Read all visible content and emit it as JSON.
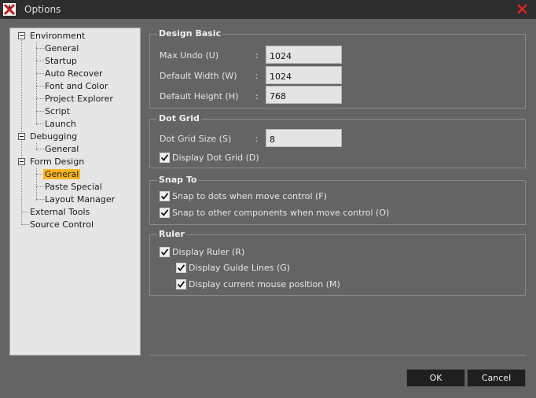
{
  "window": {
    "title": "Options"
  },
  "tree": {
    "items": [
      {
        "label": "Environment"
      },
      {
        "label": "General"
      },
      {
        "label": "Startup"
      },
      {
        "label": "Auto Recover"
      },
      {
        "label": "Font and Color"
      },
      {
        "label": "Project Explorer"
      },
      {
        "label": "Script"
      },
      {
        "label": "Launch"
      },
      {
        "label": "Debugging"
      },
      {
        "label": "General"
      },
      {
        "label": "Form Design"
      },
      {
        "label": "General"
      },
      {
        "label": "Paste Special"
      },
      {
        "label": "Layout Manager"
      },
      {
        "label": "External Tools"
      },
      {
        "label": "Source Control"
      }
    ]
  },
  "design_basic": {
    "title": "Design Basic",
    "max_undo_label": "Max Undo (U)",
    "max_undo_value": "1024",
    "default_width_label": "Default Width (W)",
    "default_width_value": "1024",
    "default_height_label": "Default Height (H)",
    "default_height_value": "768",
    "colon": ":"
  },
  "dot_grid": {
    "title": "Dot Grid",
    "size_label": "Dot Grid Size (S)",
    "size_value": "8",
    "display_label": "Display Dot Grid (D)",
    "display_checked": true
  },
  "snap_to": {
    "title": "Snap To",
    "dots_label": "Snap to dots when move control (F)",
    "components_label": "Snap to other components when move control (O)"
  },
  "ruler": {
    "title": "Ruler",
    "display_label": "Display Ruler (R)",
    "guide_label": "Display Guide Lines (G)",
    "mouse_label": "Display current mouse position (M)"
  },
  "buttons": {
    "ok": "OK",
    "cancel": "Cancel"
  },
  "colors": {
    "accent_selected": "#ffb61c",
    "close": "#e0231f"
  }
}
